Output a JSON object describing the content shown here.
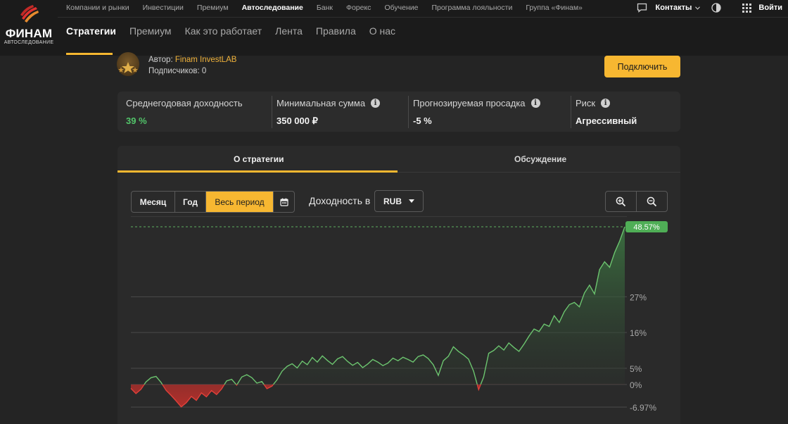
{
  "brand": {
    "name": "ФИНАМ",
    "sub": "АВТОСЛЕДОВАНИЕ"
  },
  "top_nav": [
    {
      "label": "Компании и рынки",
      "active": false
    },
    {
      "label": "Инвестиции",
      "active": false
    },
    {
      "label": "Премиум",
      "active": false
    },
    {
      "label": "Автоследование",
      "active": true
    },
    {
      "label": "Банк",
      "active": false
    },
    {
      "label": "Форекс",
      "active": false
    },
    {
      "label": "Обучение",
      "active": false
    },
    {
      "label": "Программа лояльности",
      "active": false
    },
    {
      "label": "Группа «Финам»",
      "active": false
    }
  ],
  "top_right": {
    "contacts": "Контакты",
    "login": "Войти"
  },
  "sub_nav": [
    {
      "label": "Стратегии",
      "active": true
    },
    {
      "label": "Премиум",
      "active": false
    },
    {
      "label": "Как это работает",
      "active": false
    },
    {
      "label": "Лента",
      "active": false
    },
    {
      "label": "Правила",
      "active": false
    },
    {
      "label": "О нас",
      "active": false
    }
  ],
  "author": {
    "prefix": "Автор:",
    "name": "Finam InvestLAB",
    "subscribers": "Подписчиков: 0"
  },
  "connect_label": "Подключить",
  "stats": [
    {
      "label": "Среднегодовая доходность",
      "value": "39 %",
      "info": false,
      "value_color": "#52c56a"
    },
    {
      "label": "Минимальная сумма",
      "value": "350 000 ₽",
      "info": true
    },
    {
      "label": "Прогнозируемая просадка",
      "value": "-5 %",
      "info": true
    },
    {
      "label": "Риск",
      "value": "Агрессивный",
      "info": true
    }
  ],
  "tabs": [
    {
      "label": "О стратегии",
      "active": true
    },
    {
      "label": "Обсуждение",
      "active": false
    }
  ],
  "period_options": [
    {
      "label": "Месяц",
      "selected": false
    },
    {
      "label": "Год",
      "selected": false
    },
    {
      "label": "Весь период",
      "selected": true
    }
  ],
  "yield_label": "Доходность в",
  "currency": "RUB",
  "icons": {
    "chat": "chat-icon",
    "contrast": "contrast-icon",
    "apps": "apps-grid-icon",
    "calendar": "calendar-icon",
    "zoom_in": "zoom-in-icon",
    "zoom_out": "zoom-out-icon",
    "caret": "chevron-down-icon"
  },
  "colors": {
    "accent": "#f7b731",
    "positive": "#52c56a",
    "negative": "#d83a34"
  },
  "chart_data": {
    "type": "area",
    "current_label": "48.57%",
    "y_ticks": [
      "27%",
      "16%",
      "5%",
      "0%",
      "-6.97%"
    ],
    "y_tick_values": [
      27,
      16,
      5,
      0,
      -6.97
    ],
    "ylim": [
      -6.97,
      48.57
    ],
    "values": [
      -1.2,
      -2.8,
      -1.5,
      0.8,
      2.1,
      2.5,
      0.6,
      -1.8,
      -3.4,
      -5.1,
      -6.9,
      -5.6,
      -3.7,
      -4.9,
      -2.6,
      -3.8,
      -1.9,
      -3.1,
      -1.4,
      1.1,
      1.6,
      -0.2,
      2.3,
      3.0,
      2.1,
      0.4,
      0.9,
      -1.3,
      -0.5,
      1.4,
      4.1,
      5.6,
      6.4,
      5.1,
      7.2,
      6.1,
      8.3,
      6.9,
      8.8,
      7.4,
      6.2,
      7.9,
      8.6,
      7.1,
      5.9,
      6.8,
      5.2,
      6.3,
      7.7,
      6.9,
      5.8,
      6.6,
      8.1,
      7.3,
      8.4,
      7.7,
      6.9,
      8.6,
      9.1,
      8.0,
      6.1,
      2.8,
      7.3,
      8.7,
      11.6,
      10.2,
      9.1,
      7.8,
      4.1,
      -1.6,
      2.3,
      9.6,
      10.5,
      11.9,
      10.6,
      12.8,
      11.4,
      10.2,
      12.4,
      14.9,
      17.1,
      16.3,
      18.6,
      17.9,
      21.2,
      19.1,
      22.4,
      24.6,
      25.3,
      23.9,
      28.2,
      30.6,
      27.9,
      35.4,
      37.8,
      36.1,
      40.7,
      44.2,
      48.57
    ]
  }
}
